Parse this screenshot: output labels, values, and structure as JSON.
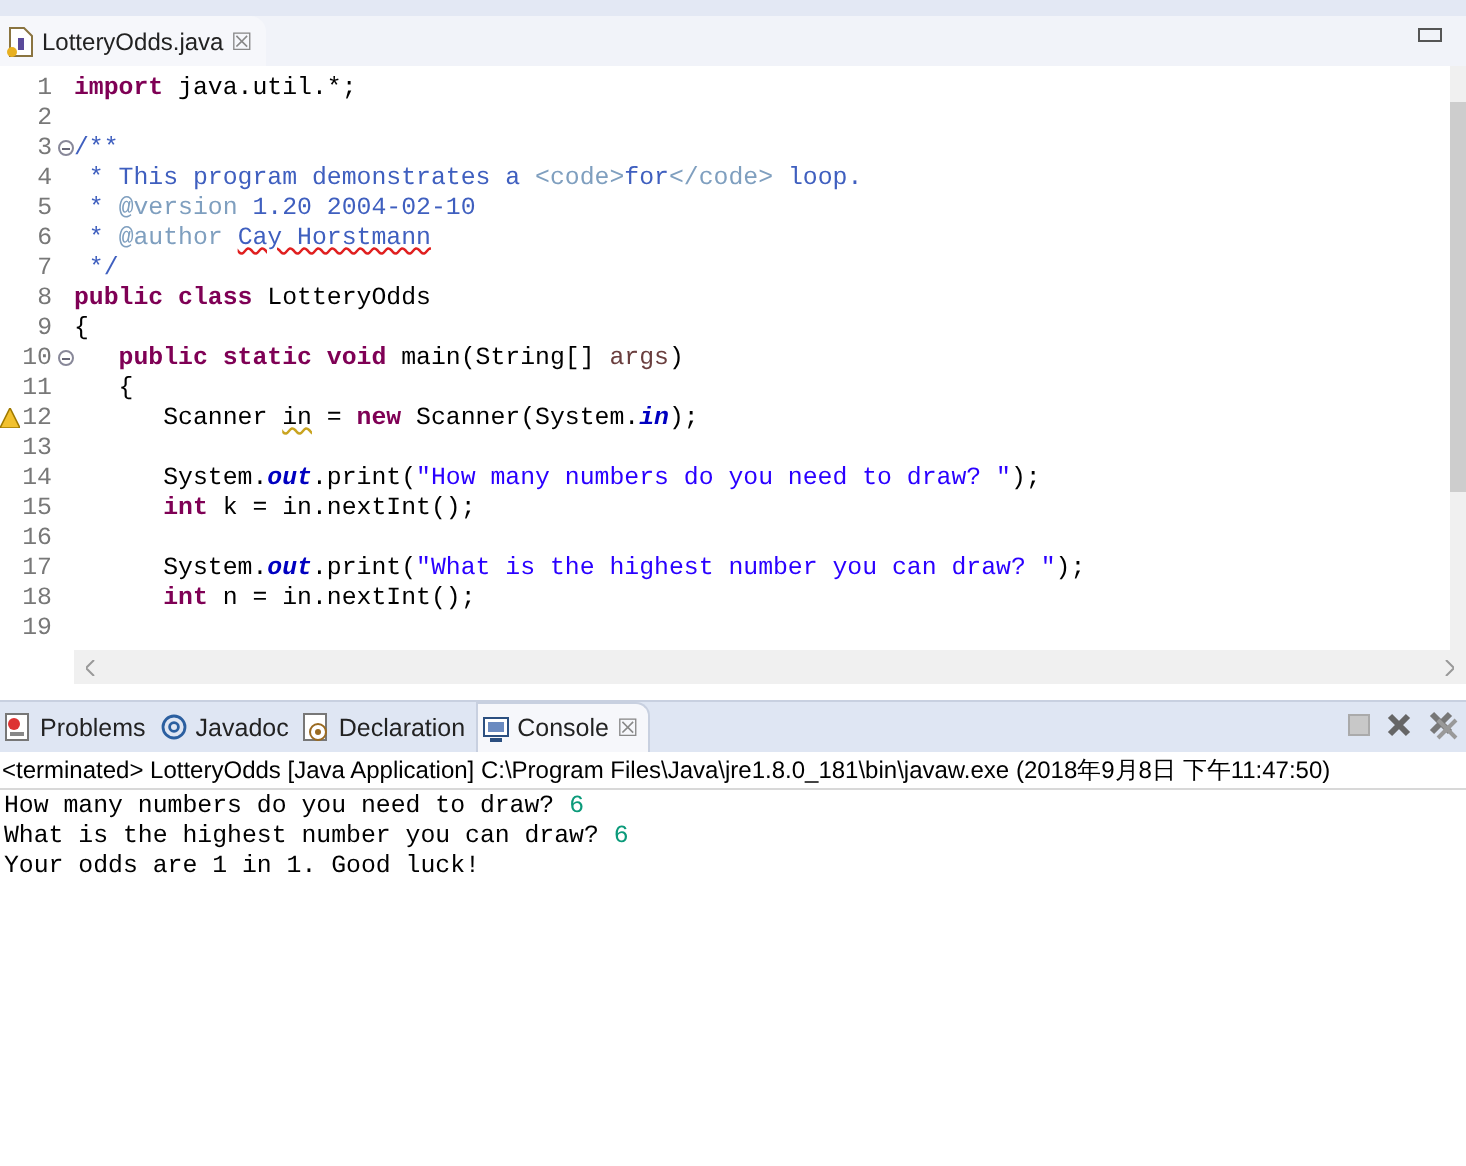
{
  "editor": {
    "tab": {
      "label": "LotteryOdds.java",
      "close": "☒",
      "selected": true
    },
    "lines": [
      {
        "number": "1",
        "fold": false,
        "warning": false,
        "tokens": [
          {
            "kind": "keyword",
            "text": "import"
          },
          {
            "kind": "text",
            "text": " java.util.*;"
          }
        ]
      },
      {
        "number": "2",
        "fold": false,
        "warning": false
      },
      {
        "number": "3",
        "fold": true,
        "warning": false,
        "tokens": [
          {
            "kind": "comment",
            "text": "/**"
          }
        ]
      },
      {
        "number": "4",
        "fold": false,
        "warning": false,
        "tokens": [
          {
            "kind": "comment",
            "text": " * This program demonstrates a "
          },
          {
            "kind": "tag",
            "text": "<code>"
          },
          {
            "kind": "comment",
            "text": "for"
          },
          {
            "kind": "tag",
            "text": "</code>"
          },
          {
            "kind": "comment",
            "text": " loop."
          }
        ]
      },
      {
        "number": "5",
        "fold": false,
        "warning": false,
        "tokens": [
          {
            "kind": "comment",
            "text": " * "
          },
          {
            "kind": "tag",
            "text": "@version"
          },
          {
            "kind": "comment",
            "text": " 1.20 2004-02-10"
          }
        ]
      },
      {
        "number": "6",
        "fold": false,
        "warning": false,
        "tokens": [
          {
            "kind": "comment",
            "text": " * "
          },
          {
            "kind": "tag",
            "text": "@author "
          },
          {
            "kind": "spelling",
            "text": "Cay Horstmann"
          }
        ]
      },
      {
        "number": "7",
        "fold": false,
        "warning": false,
        "tokens": [
          {
            "kind": "comment",
            "text": " */"
          }
        ]
      },
      {
        "number": "8",
        "fold": false,
        "warning": false,
        "tokens": [
          {
            "kind": "keyword",
            "text": "public class"
          },
          {
            "kind": "text",
            "text": " LotteryOdds"
          }
        ]
      },
      {
        "number": "9",
        "fold": false,
        "warning": false,
        "tokens": [
          {
            "kind": "text",
            "text": "{"
          }
        ]
      },
      {
        "number": "10",
        "fold": true,
        "warning": false,
        "tokens": [
          {
            "kind": "keyword",
            "text": "   public static void"
          },
          {
            "kind": "text",
            "text": " main(String[] "
          },
          {
            "kind": "param",
            "text": "args"
          },
          {
            "kind": "text",
            "text": ")"
          }
        ]
      },
      {
        "number": "11",
        "fold": false,
        "warning": false,
        "tokens": [
          {
            "kind": "text",
            "text": "   {"
          }
        ]
      },
      {
        "number": "12",
        "fold": false,
        "warning": true,
        "tokens": [
          {
            "kind": "text",
            "text": "      Scanner "
          },
          {
            "kind": "warn",
            "text": "in"
          },
          {
            "kind": "text",
            "text": " = "
          },
          {
            "kind": "keyword",
            "text": "new"
          },
          {
            "kind": "text",
            "text": " Scanner(System."
          },
          {
            "kind": "field",
            "text": "in"
          },
          {
            "kind": "text",
            "text": ");"
          }
        ]
      },
      {
        "number": "13",
        "fold": false,
        "warning": false
      },
      {
        "number": "14",
        "fold": false,
        "warning": false,
        "tokens": [
          {
            "kind": "text",
            "text": "      System."
          },
          {
            "kind": "field",
            "text": "out"
          },
          {
            "kind": "text",
            "text": ".print("
          },
          {
            "kind": "string",
            "text": "\"How many numbers do you need to draw? \""
          },
          {
            "kind": "text",
            "text": ");"
          }
        ]
      },
      {
        "number": "15",
        "fold": false,
        "warning": false,
        "tokens": [
          {
            "kind": "keyword",
            "text": "      int"
          },
          {
            "kind": "text",
            "text": " k = in.nextInt();"
          }
        ]
      },
      {
        "number": "16",
        "fold": false,
        "warning": false
      },
      {
        "number": "17",
        "fold": false,
        "warning": false,
        "tokens": [
          {
            "kind": "text",
            "text": "      System."
          },
          {
            "kind": "field",
            "text": "out"
          },
          {
            "kind": "text",
            "text": ".print("
          },
          {
            "kind": "string",
            "text": "\"What is the highest number you can draw? \""
          },
          {
            "kind": "text",
            "text": ");"
          }
        ]
      },
      {
        "number": "18",
        "fold": false,
        "warning": false,
        "tokens": [
          {
            "kind": "keyword",
            "text": "      int"
          },
          {
            "kind": "text",
            "text": " n = in.nextInt();"
          }
        ]
      },
      {
        "number": "19",
        "fold": false,
        "warning": false
      }
    ]
  },
  "views": {
    "tabs": [
      {
        "label": "Problems",
        "selected": false
      },
      {
        "label": "Javadoc",
        "selected": false
      },
      {
        "label": "Declaration",
        "selected": false
      },
      {
        "label": "Console",
        "selected": true,
        "close": "☒"
      }
    ],
    "header": "<terminated> LotteryOdds [Java Application] C:\\Program Files\\Java\\jre1.8.0_181\\bin\\javaw.exe (2018年9月8日 下午11:47:50)",
    "output": [
      {
        "segments": [
          {
            "kind": "out",
            "text": "How many numbers do you need to draw? "
          },
          {
            "kind": "in",
            "text": "6"
          }
        ]
      },
      {
        "segments": [
          {
            "kind": "out",
            "text": "What is the highest number you can draw? "
          },
          {
            "kind": "in",
            "text": "6"
          }
        ]
      },
      {
        "segments": [
          {
            "kind": "out",
            "text": "Your odds are 1 in 1. Good luck!"
          }
        ]
      }
    ]
  }
}
